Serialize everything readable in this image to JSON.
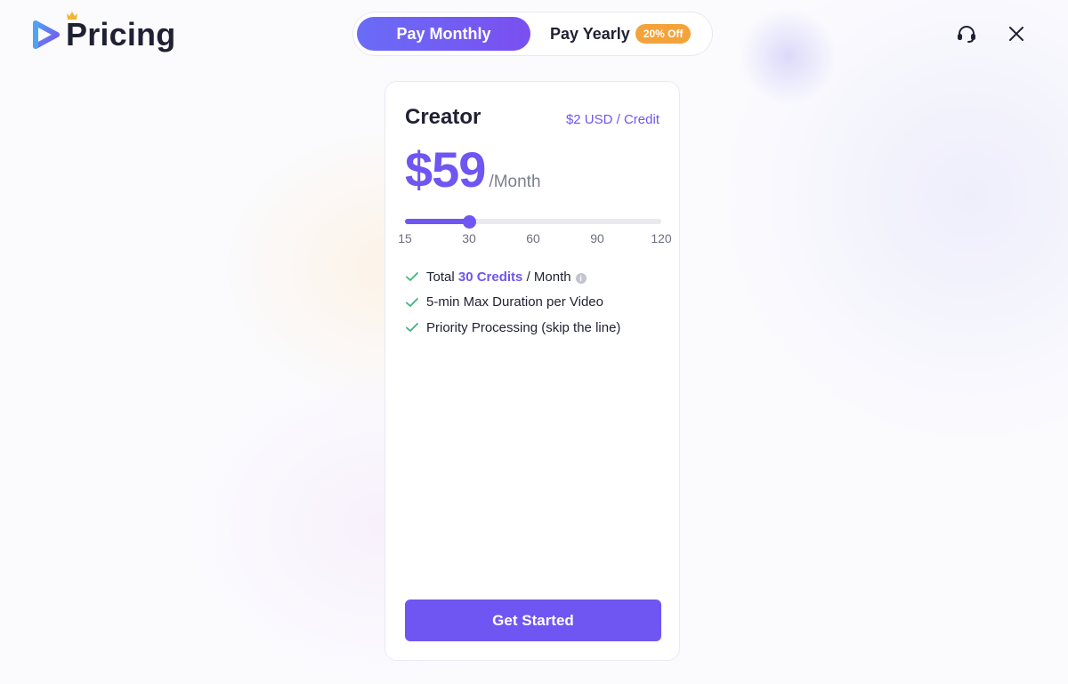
{
  "header": {
    "title": "Pricing",
    "billing_toggle": {
      "monthly_label": "Pay Monthly",
      "yearly_label": "Pay Yearly",
      "yearly_badge": "20% Off",
      "selected": "monthly"
    },
    "icons": [
      "logo-icon",
      "crown-icon",
      "headset-icon",
      "close-icon"
    ]
  },
  "plan": {
    "name": "Creator",
    "credit_rate": "$2 USD / Credit",
    "price": "$59",
    "period": "/Month",
    "slider": {
      "min": 15,
      "max": 120,
      "value": 30,
      "ticks": [
        "15",
        "30",
        "60",
        "90",
        "120"
      ]
    },
    "features": {
      "credits_prefix": "Total",
      "credits_value": "30 Credits",
      "credits_suffix": "/ Month",
      "info_glyph": "i",
      "duration": "5-min Max Duration per Video",
      "priority": "Priority Processing (skip the line)"
    },
    "cta_label": "Get Started"
  },
  "colors": {
    "accent": "#6f55f2",
    "toggle_gradient_start": "#6a6cf6",
    "toggle_gradient_end": "#7a4ff0",
    "badge": "#f3a33a",
    "check": "#3fb37f",
    "text": "#1f2133",
    "muted": "#7c7f8f"
  }
}
